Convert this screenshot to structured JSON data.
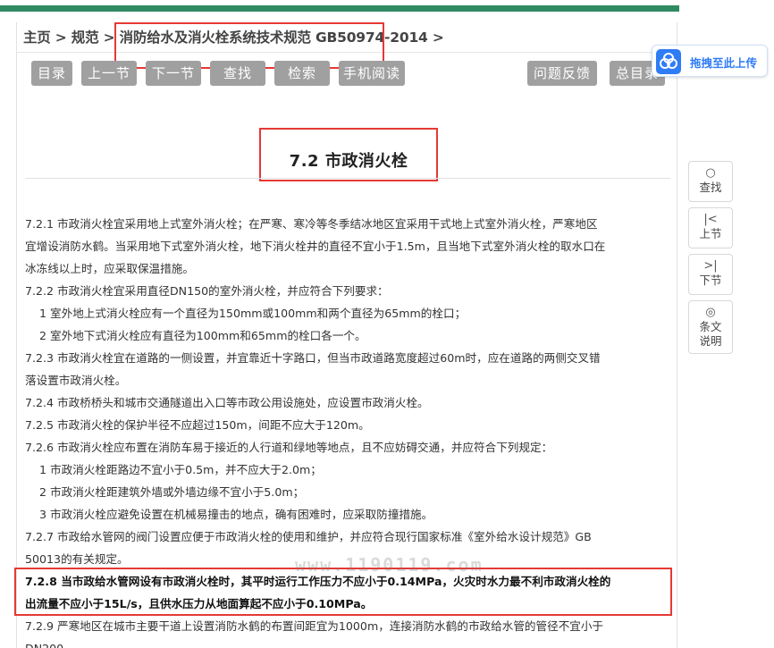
{
  "breadcrumb": {
    "home": "主页",
    "sep1": " > ",
    "spec": "规范",
    "sep2": " > ",
    "current": "消防给水及消火栓系统技术规范 GB50974-2014",
    "sep3": " >"
  },
  "toolbar": {
    "toc": "目录",
    "prev": "上一节",
    "next": "下一节",
    "find": "查找",
    "search": "检索",
    "mobile": "手机阅读",
    "feedback": "问题反馈",
    "all_toc": "总目录"
  },
  "upload": {
    "label": "拖拽至此上传",
    "icon": "cloud-upload-icon"
  },
  "side": {
    "find": {
      "label": "查找",
      "icon": "search-icon",
      "glyph": "○"
    },
    "prev": {
      "label": "上节",
      "icon": "skip-prev-icon",
      "glyph": "|<"
    },
    "next": {
      "label": "下节",
      "icon": "skip-next-icon",
      "glyph": ">|"
    },
    "explain": {
      "label1": "条文",
      "label2": "说明",
      "icon": "eye-icon",
      "glyph": "◎"
    }
  },
  "section_title": "7.2  市政消火栓",
  "watermark": "www.1190119.com",
  "paragraphs": [
    "7.2.1 市政消火栓宜采用地上式室外消火栓；在严寒、寒冷等冬季结冰地区宜采用干式地上式室外消火栓，严寒地区",
    "宜增设消防水鹤。当采用地下式室外消火栓，地下消火栓井的直径不宜小于1.5m，且当地下式室外消火栓的取水口在",
    "冰冻线以上时，应采取保温措施。",
    "7.2.2 市政消火栓宜采用直径DN150的室外消火栓，并应符合下列要求：",
    "1 室外地上式消火栓应有一个直径为150mm或100mm和两个直径为65mm的栓口；",
    "2 室外地下式消火栓应有直径为100mm和65mm的栓口各一个。",
    "7.2.3 市政消火栓宜在道路的一侧设置，并宜靠近十字路口，但当市政道路宽度超过60m时，应在道路的两侧交叉错",
    "落设置市政消火栓。",
    "7.2.4 市政桥桥头和城市交通隧道出入口等市政公用设施处，应设置市政消火栓。",
    "7.2.5 市政消火栓的保护半径不应超过150m，间距不应大于120m。",
    "7.2.6 市政消火栓应布置在消防车易于接近的人行道和绿地等地点，且不应妨碍交通，并应符合下列规定：",
    "1 市政消火栓距路边不宜小于0.5m，并不应大于2.0m；",
    "2 市政消火栓距建筑外墙或外墙边缘不宜小于5.0m；",
    "3 市政消火栓应避免设置在机械易撞击的地点，确有困难时，应采取防撞措施。",
    "7.2.7 市政给水管网的阀门设置应便于市政消火栓的使用和维护，并应符合现行国家标准《室外给水设计规范》GB",
    "50013的有关规定。",
    "7.2.8 当市政给水管网设有市政消火栓时，其平时运行工作压力不应小于0.14MPa，火灾时水力最不利市政消火栓的",
    "出流量不应小于15L/s，且供水压力从地面算起不应小于0.10MPa。",
    "7.2.9 严寒地区在城市主要干道上设置消防水鹤的布置间距宜为1000m，连接消防水鹤的市政给水管的管径不宜小于",
    "DN200。"
  ]
}
